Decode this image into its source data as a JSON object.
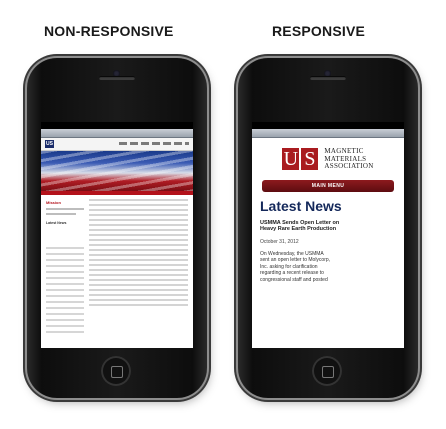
{
  "labels": {
    "left": "NON-RESPONSIVE",
    "right": "RESPONSIVE"
  },
  "desktop_site": {
    "logo": "US",
    "section_title": "Mission",
    "news_heading": "Latest News"
  },
  "mobile_site": {
    "logo_letters": [
      "U",
      "S"
    ],
    "logo_lines": [
      "MAGNETIC",
      "MATERIALS",
      "ASSOCIATION"
    ],
    "menu_label": "MAIN MENU",
    "news_heading": "Latest News",
    "article_title_1": "USMMA Sends Open Letter on",
    "article_title_2": "Heavy Rare Earth Production",
    "article_date": "October 31, 2012",
    "article_lines": [
      "On Wednesday, the USMMA",
      "sent an open letter to Molycorp,",
      "Inc. asking for clarification",
      "regarding a recent release to",
      "congressional staff and posted"
    ]
  },
  "icons": [
    "phone-speaker-icon",
    "front-camera-icon",
    "home-button-icon"
  ],
  "colors": {
    "brand_red": "#a91b1f",
    "brand_navy": "#14285a",
    "phone_body": "#111111"
  }
}
